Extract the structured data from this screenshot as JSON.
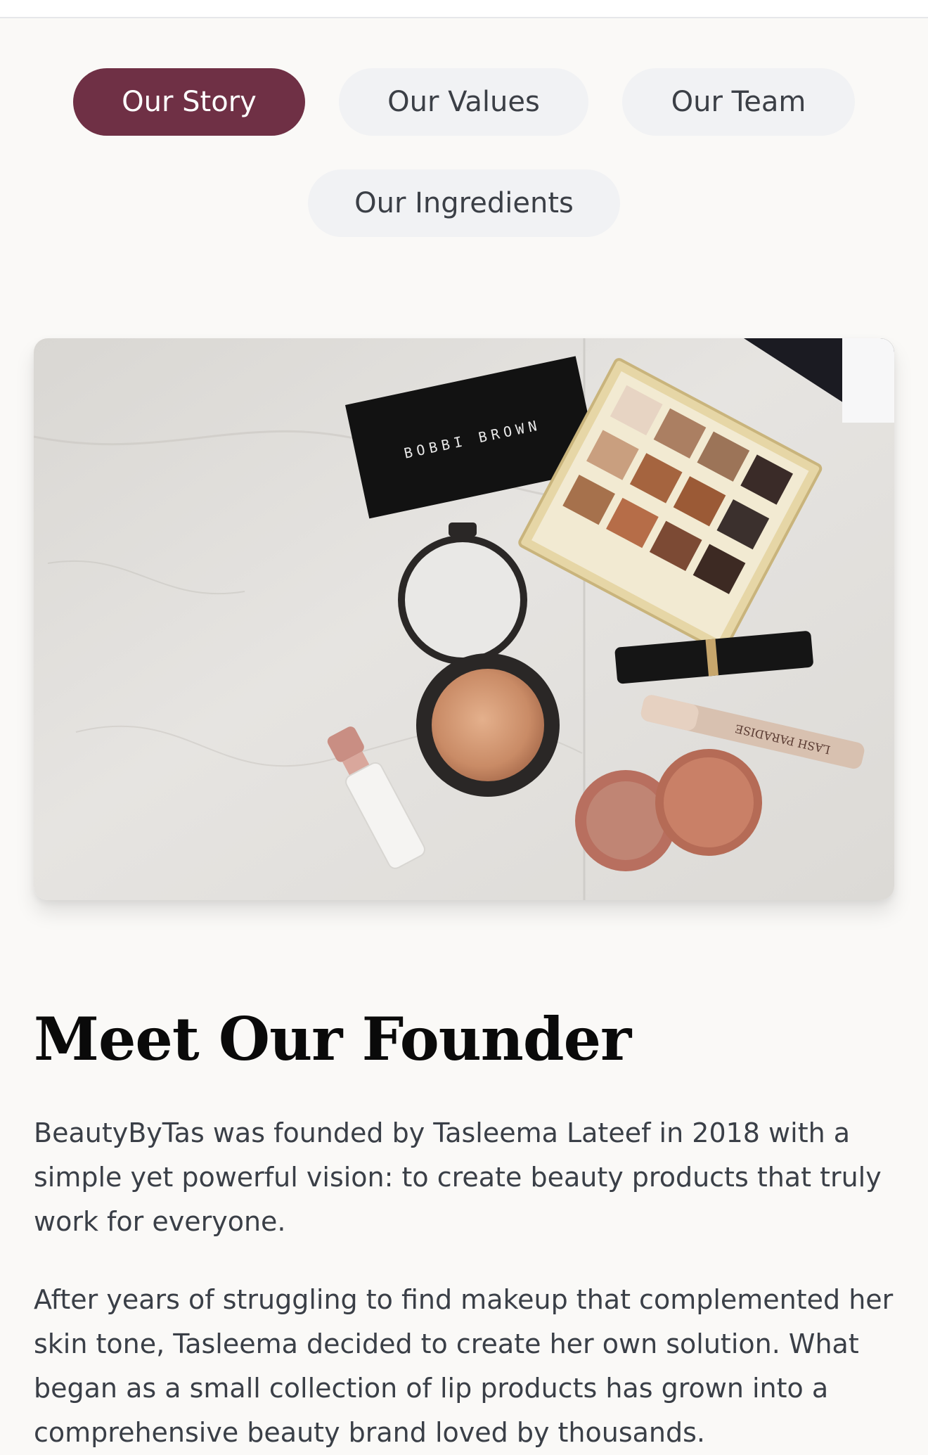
{
  "tabs": [
    {
      "label": "Our Story",
      "active": true
    },
    {
      "label": "Our Values",
      "active": false
    },
    {
      "label": "Our Team",
      "active": false
    },
    {
      "label": "Our Ingredients",
      "active": false
    }
  ],
  "hero_image": {
    "subject": "makeup products on marble",
    "compact_brand": "BOBBI BROWN",
    "mascara_label": "LASH PARADISE"
  },
  "founder": {
    "title": "Meet Our Founder",
    "paragraphs": [
      "BeautyByTas was founded by Tasleema Lateef in 2018 with a simple yet powerful vision: to create beauty products that truly work for everyone.",
      "After years of struggling to find makeup that complemented her skin tone, Tasleema decided to create her own solution. What began as a small collection of lip products has grown into a comprehensive beauty brand loved by thousands."
    ]
  },
  "colors": {
    "accent": "#6f3045",
    "tab_bg": "#f1f2f4",
    "page_bg": "#faf9f7"
  }
}
